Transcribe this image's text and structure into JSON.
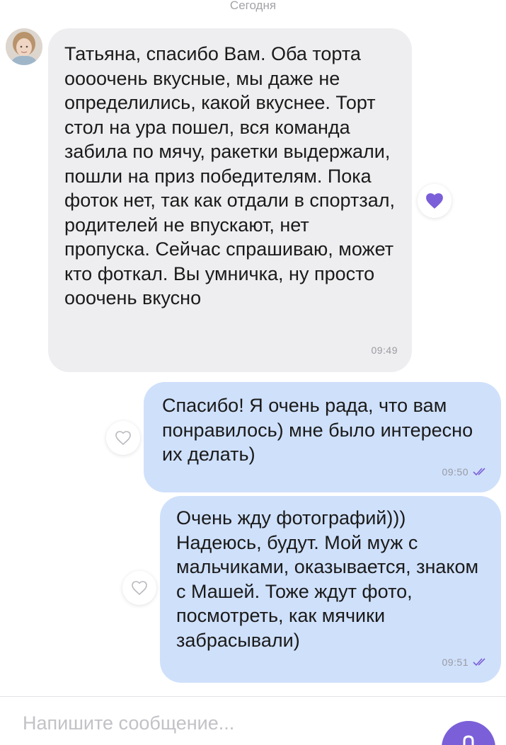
{
  "chat": {
    "date_label": "Сегодня",
    "messages": [
      {
        "direction": "incoming",
        "text": "Татьяна, спасибо Вам. Оба торта оооочень вкусные, мы даже не определились, какой вкуснее. Торт стол на ура пошел, вся команда забила по мячу, ракетки выдержали, пошли на приз победителям. Пока фоток нет, так как отдали в спортзал, родителей не впускают, нет пропуска.  Сейчас спрашиваю, может кто фоткал. Вы умничка, ну просто ооочень вкусно",
        "time": "09:49",
        "reaction": "heart-filled"
      },
      {
        "direction": "outgoing",
        "text": "Спасибо! Я очень рада, что вам понравилось) мне было интересно их делать)",
        "time": "09:50",
        "status": "read"
      },
      {
        "direction": "outgoing",
        "text": "Очень жду фотографий))) Надеюсь, будут. Мой муж с мальчиками, оказывается, знаком с Машей. Тоже ждут фото, посмотреть, как мячики забрасывали)",
        "time": "09:51",
        "status": "read"
      }
    ]
  },
  "composer": {
    "placeholder": "Напишите сообщение...",
    "value": ""
  },
  "icons": {
    "like_filled": "heart-filled-icon",
    "like_empty": "heart-outline-icon",
    "read_status": "double-check-icon",
    "send": "send-icon"
  },
  "colors": {
    "accent": "#7b5fd8",
    "incoming_bubble": "#eeeef0",
    "outgoing_bubble": "#cfe0fb"
  }
}
